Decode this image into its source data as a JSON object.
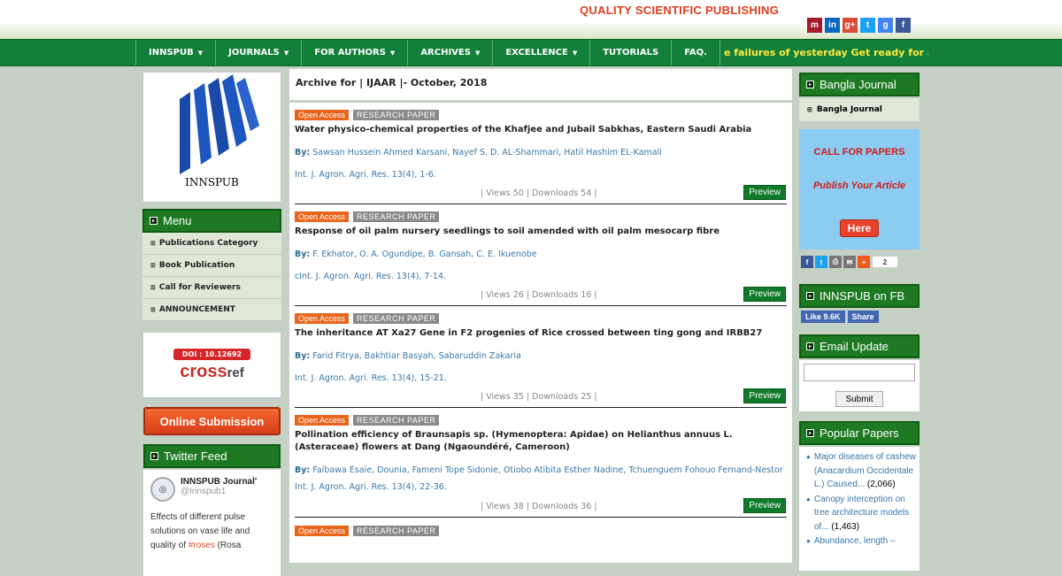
{
  "header": {
    "brand": "QUALITY SCIENTIFIC PUBLISHING",
    "social_icons": [
      {
        "name": "mendeley-icon",
        "glyph": "m",
        "color": "#a6192e"
      },
      {
        "name": "linkedin-icon",
        "glyph": "in",
        "color": "#0a66c2"
      },
      {
        "name": "googleplus-icon",
        "glyph": "g+",
        "color": "#dd4b39"
      },
      {
        "name": "twitter-icon",
        "glyph": "t",
        "color": "#1da1f2"
      },
      {
        "name": "google-icon",
        "glyph": "g",
        "color": "#4285f4"
      },
      {
        "name": "facebook-icon",
        "glyph": "f",
        "color": "#3b5998"
      }
    ]
  },
  "nav": {
    "items": [
      "INNSPUB",
      "JOURNALS",
      "FOR AUTHORS",
      "ARCHIVES",
      "EXCELLENCE",
      "TUTORIALS",
      "FAQ."
    ],
    "marquee": "e failures of yesterday Get ready for a new b"
  },
  "left": {
    "logo_text": "INNSPUB",
    "menu_title": "Menu",
    "menu_items": [
      "Publications Category",
      "Book Publication",
      "Call for Reviewers",
      "ANNOUNCEMENT"
    ],
    "doi": "DOI : 10.12692",
    "crossref": "cross",
    "crossref_ref": "ref",
    "online_submission": "Online Submission",
    "twitter_title": "Twitter Feed",
    "tweet": {
      "name": "INNSPUB Journal'",
      "handle": "@Innspub1",
      "text": "Effects of different pulse solutions on vase life and quality of ",
      "hashtag": "#roses",
      "text_after": " (Rosa"
    }
  },
  "main": {
    "archive_title": "Archive for | IJAAR |- October, 2018",
    "articles": [
      {
        "open_access": "Open Access",
        "type": "RESEARCH PAPER",
        "title": "Water physico-chemical properties of the Khafjee and Jubail Sabkhas, Eastern Saudi Arabia",
        "by": "By:",
        "authors": "Sawsan Hussein Ahmed Karsani, Nayef S. D. AL-Shammari, Hatil Hashim EL-Kamali",
        "journal": "Int. J. Agron. Agri. Res. 13(4), 1-6.",
        "stats": "| Views 50 | Downloads 54 |",
        "preview": "Preview"
      },
      {
        "open_access": "Open Access",
        "type": "RESEARCH PAPER",
        "title": "Response of oil palm nursery seedlings to soil amended with oil palm mesocarp fibre",
        "by": "By:",
        "authors": "F. Ekhator, O. A. Ogundipe, B. Gansah, C. E. Ikuenobe",
        "journal": "cInt. J. Agron. Agri. Res. 13(4), 7-14.",
        "stats": "| Views 26 | Downloads 16 |",
        "preview": "Preview"
      },
      {
        "open_access": "Open Access",
        "type": "RESEARCH PAPER",
        "title": "The inheritance AT Xa27 Gene in F2 progenies of Rice crossed between ting gong and IRBB27",
        "by": "By:",
        "authors": "Farid Fitrya, Bakhtiar Basyah, Sabaruddin Zakaria",
        "journal": "Int. J. Agron. Agri. Res. 13(4), 15-21.",
        "stats": "| Views 35 | Downloads 25 |",
        "preview": "Preview"
      },
      {
        "open_access": "Open Access",
        "type": "RESEARCH PAPER",
        "title": "Pollination efficiency of Braunsapis sp. (Hymenoptera: Apidae) on Helianthus annuus L. (Asteraceae) flowers at Dang (Ngaoundéré, Cameroon)",
        "by": "By:",
        "authors": "Faïbawa Esaïe, Dounia, Fameni Tope Sidonie, Otiobo Atibita Esther Nadine, Tchuenguem Fohouo Fernand-Nestor",
        "journal": "Int. J. Agron. Agri. Res. 13(4), 22-36.",
        "stats": "| Views 38 | Downloads 36 |",
        "preview": "Preview"
      }
    ],
    "next_open_access": "Open Access",
    "next_type": "RESEARCH PAPER"
  },
  "right": {
    "bangla_title": "Bangla Journal",
    "bangla_item": "Bangla Journal",
    "cfp_title": "CALL FOR PAPERS",
    "cfp_sub": "Publish Your Article",
    "cfp_button": "Here",
    "share_count": "2",
    "fb_title": "INNSPUB on FB",
    "fb_like": "Like 9.6K",
    "fb_share": "Share",
    "email_title": "Email Update",
    "email_submit": "Submit",
    "popular_title": "Popular Papers",
    "popular": [
      {
        "title": "Major diseases of cashew (Anacardium Occidentale L.) Caused...",
        "count": "(2,066)"
      },
      {
        "title": "Canopy interception on tree architecture models of...",
        "count": "(1,463)"
      },
      {
        "title": "Abundance, length –",
        "count": ""
      }
    ]
  }
}
